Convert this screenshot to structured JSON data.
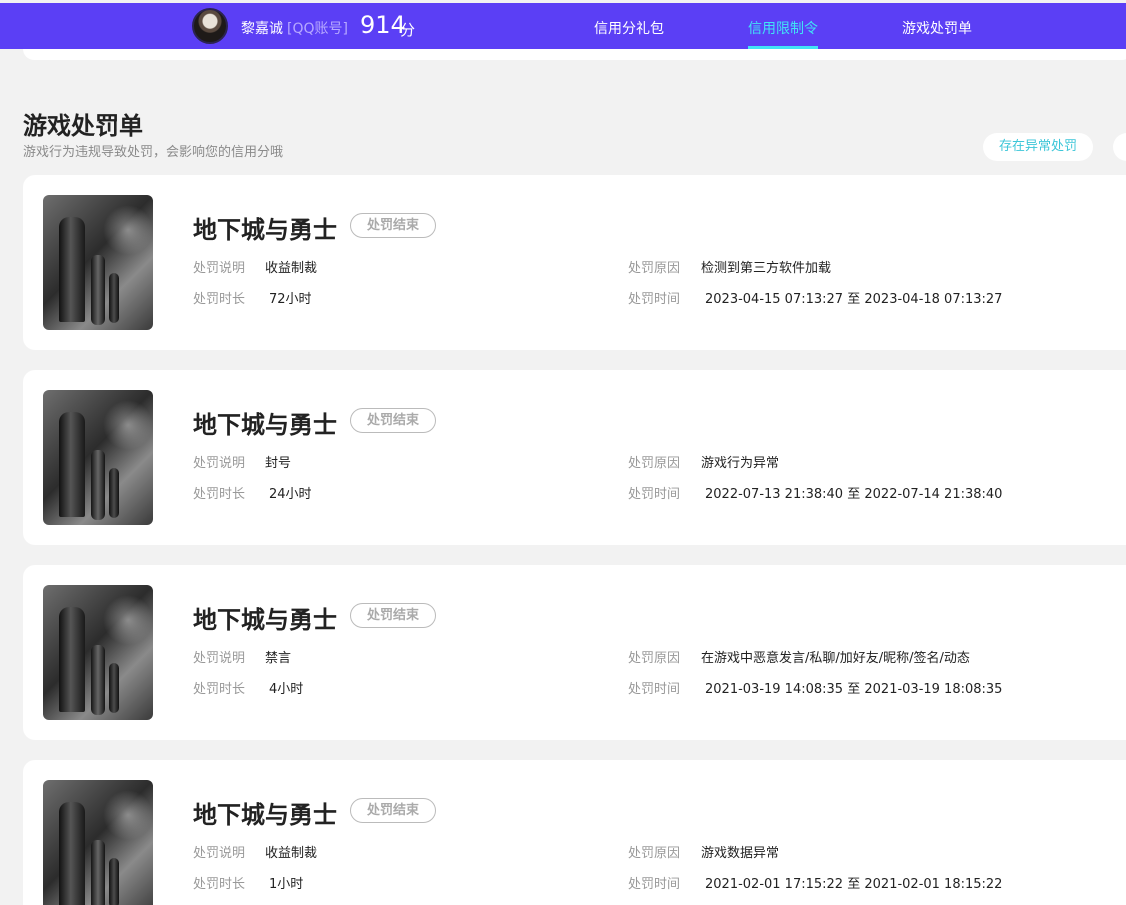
{
  "header": {
    "username": "黎嘉诚",
    "account_type": "[QQ账号]",
    "score": "914",
    "score_unit": "分",
    "nav": [
      {
        "label": "信用分礼包"
      },
      {
        "label": "信用限制令"
      },
      {
        "label": "游戏处罚单"
      }
    ],
    "active_nav": "信用限制令",
    "accent_color": "#41e3f6",
    "bar_color": "#5b3ff5"
  },
  "section": {
    "title": "游戏处罚单",
    "subtitle": "游戏行为违规导致处罚，会影响您的信用分哦",
    "filter_label": "存在异常处罚"
  },
  "labels": {
    "desc": "处罚说明",
    "duration": "处罚时长",
    "reason": "处罚原因",
    "time": "处罚时间",
    "to": "至"
  },
  "records": [
    {
      "game": "地下城与勇士",
      "status": "处罚结束",
      "desc": "收益制裁",
      "duration": "72小时",
      "reason": "检测到第三方软件加载",
      "start": "2023-04-15 07:13:27",
      "end": "2023-04-18 07:13:27"
    },
    {
      "game": "地下城与勇士",
      "status": "处罚结束",
      "desc": "封号",
      "duration": "24小时",
      "reason": "游戏行为异常",
      "start": "2022-07-13 21:38:40",
      "end": "2022-07-14 21:38:40"
    },
    {
      "game": "地下城与勇士",
      "status": "处罚结束",
      "desc": "禁言",
      "duration": "4小时",
      "reason": "在游戏中恶意发言/私聊/加好友/昵称/签名/动态",
      "start": "2021-03-19 14:08:35",
      "end": "2021-03-19 18:08:35"
    },
    {
      "game": "地下城与勇士",
      "status": "处罚结束",
      "desc": "收益制裁",
      "duration": "1小时",
      "reason": "游戏数据异常",
      "start": "2021-02-01 17:15:22",
      "end": "2021-02-01 18:15:22"
    }
  ]
}
